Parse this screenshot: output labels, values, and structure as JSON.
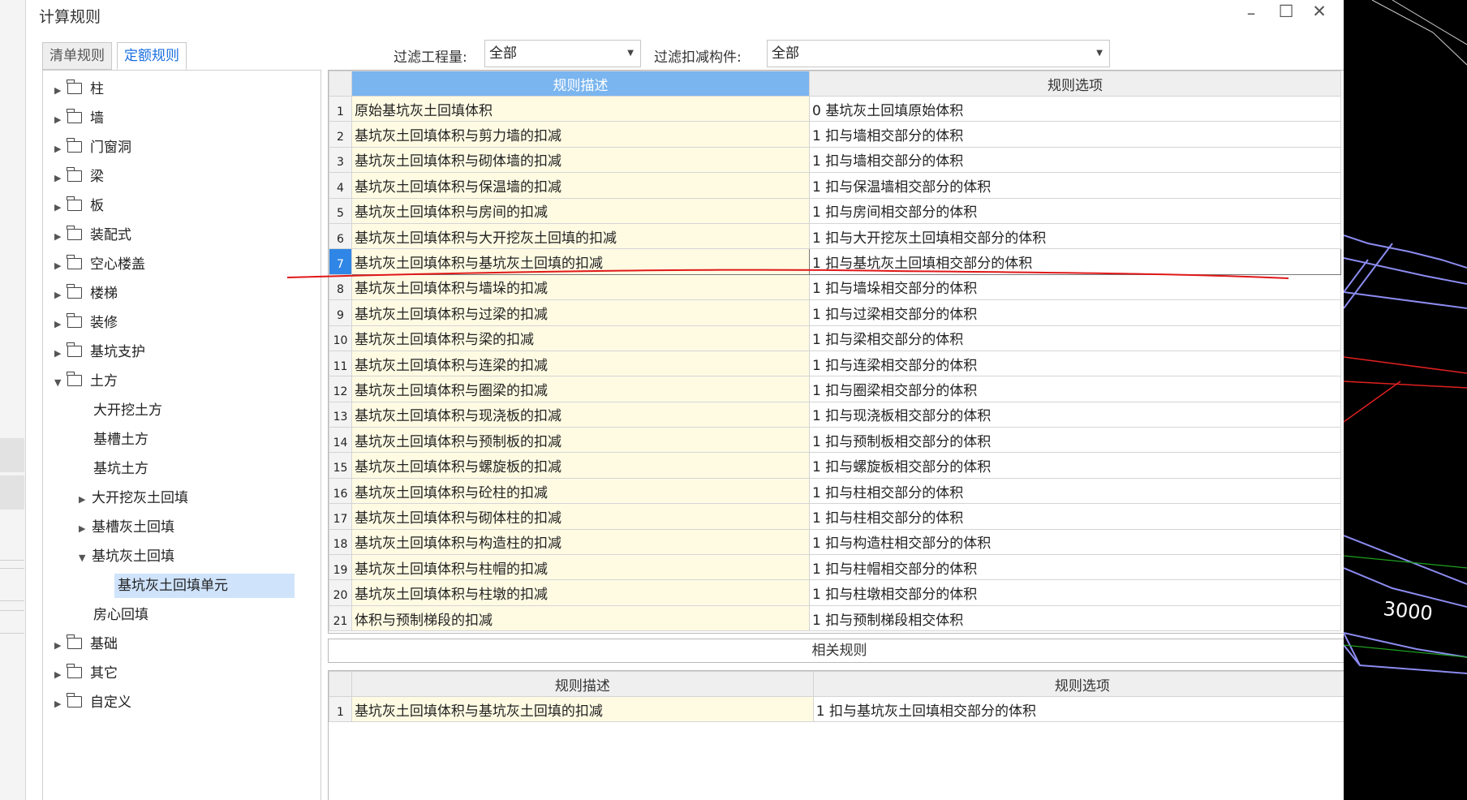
{
  "window": {
    "title": "计算规则"
  },
  "tabs": [
    {
      "label": "清单规则"
    },
    {
      "label": "定额规则"
    }
  ],
  "filters": {
    "quantity": {
      "label": "过滤工程量:",
      "value": "全部"
    },
    "component": {
      "label": "过滤扣减构件:",
      "value": "全部"
    }
  },
  "tree": [
    {
      "label": "柱"
    },
    {
      "label": "墙"
    },
    {
      "label": "门窗洞"
    },
    {
      "label": "梁"
    },
    {
      "label": "板"
    },
    {
      "label": "装配式"
    },
    {
      "label": "空心楼盖"
    },
    {
      "label": "楼梯"
    },
    {
      "label": "装修"
    },
    {
      "label": "基坑支护"
    },
    {
      "label": "土方"
    },
    {
      "label": "大开挖土方"
    },
    {
      "label": "基槽土方"
    },
    {
      "label": "基坑土方"
    },
    {
      "label": "大开挖灰土回填"
    },
    {
      "label": "基槽灰土回填"
    },
    {
      "label": "基坑灰土回填"
    },
    {
      "label": "基坑灰土回填单元"
    },
    {
      "label": "房心回填"
    },
    {
      "label": "基础"
    },
    {
      "label": "其它"
    },
    {
      "label": "自定义"
    }
  ],
  "grid": {
    "headers": {
      "desc": "规则描述",
      "option": "规则选项"
    },
    "rows": [
      {
        "n": "1",
        "desc": "原始基坑灰土回填体积",
        "option": "0 基坑灰土回填原始体积"
      },
      {
        "n": "2",
        "desc": "基坑灰土回填体积与剪力墙的扣减",
        "option": "1 扣与墙相交部分的体积"
      },
      {
        "n": "3",
        "desc": "基坑灰土回填体积与砌体墙的扣减",
        "option": "1 扣与墙相交部分的体积"
      },
      {
        "n": "4",
        "desc": "基坑灰土回填体积与保温墙的扣减",
        "option": "1 扣与保温墙相交部分的体积"
      },
      {
        "n": "5",
        "desc": "基坑灰土回填体积与房间的扣减",
        "option": "1 扣与房间相交部分的体积"
      },
      {
        "n": "6",
        "desc": "基坑灰土回填体积与大开挖灰土回填的扣减",
        "option": "1 扣与大开挖灰土回填相交部分的体积"
      },
      {
        "n": "7",
        "desc": "基坑灰土回填体积与基坑灰土回填的扣减",
        "option": "1 扣与基坑灰土回填相交部分的体积"
      },
      {
        "n": "8",
        "desc": "基坑灰土回填体积与墙垛的扣减",
        "option": "1 扣与墙垛相交部分的体积"
      },
      {
        "n": "9",
        "desc": "基坑灰土回填体积与过梁的扣减",
        "option": "1 扣与过梁相交部分的体积"
      },
      {
        "n": "10",
        "desc": "基坑灰土回填体积与梁的扣减",
        "option": "1 扣与梁相交部分的体积"
      },
      {
        "n": "11",
        "desc": "基坑灰土回填体积与连梁的扣减",
        "option": "1 扣与连梁相交部分的体积"
      },
      {
        "n": "12",
        "desc": "基坑灰土回填体积与圈梁的扣减",
        "option": "1 扣与圈梁相交部分的体积"
      },
      {
        "n": "13",
        "desc": "基坑灰土回填体积与现浇板的扣减",
        "option": "1 扣与现浇板相交部分的体积"
      },
      {
        "n": "14",
        "desc": "基坑灰土回填体积与预制板的扣减",
        "option": "1 扣与预制板相交部分的体积"
      },
      {
        "n": "15",
        "desc": "基坑灰土回填体积与螺旋板的扣减",
        "option": "1 扣与螺旋板相交部分的体积"
      },
      {
        "n": "16",
        "desc": "基坑灰土回填体积与砼柱的扣减",
        "option": "1 扣与柱相交部分的体积"
      },
      {
        "n": "17",
        "desc": "基坑灰土回填体积与砌体柱的扣减",
        "option": "1 扣与柱相交部分的体积"
      },
      {
        "n": "18",
        "desc": "基坑灰土回填体积与构造柱的扣减",
        "option": "1 扣与构造柱相交部分的体积"
      },
      {
        "n": "19",
        "desc": "基坑灰土回填体积与柱帽的扣减",
        "option": "1 扣与柱帽相交部分的体积"
      },
      {
        "n": "20",
        "desc": "基坑灰土回填体积与柱墩的扣减",
        "option": "1 扣与柱墩相交部分的体积"
      },
      {
        "n": "21",
        "desc": "体积与预制梯段的扣减",
        "option": "1 扣与预制梯段相交体积"
      }
    ]
  },
  "related": {
    "title": "相关规则",
    "headers": {
      "desc": "规则描述",
      "option": "规则选项"
    },
    "rows": [
      {
        "n": "1",
        "desc": "基坑灰土回填体积与基坑灰土回填的扣减",
        "option": "1 扣与基坑灰土回填相交部分的体积"
      }
    ]
  },
  "viewport": {
    "dimension_label": "3000"
  }
}
